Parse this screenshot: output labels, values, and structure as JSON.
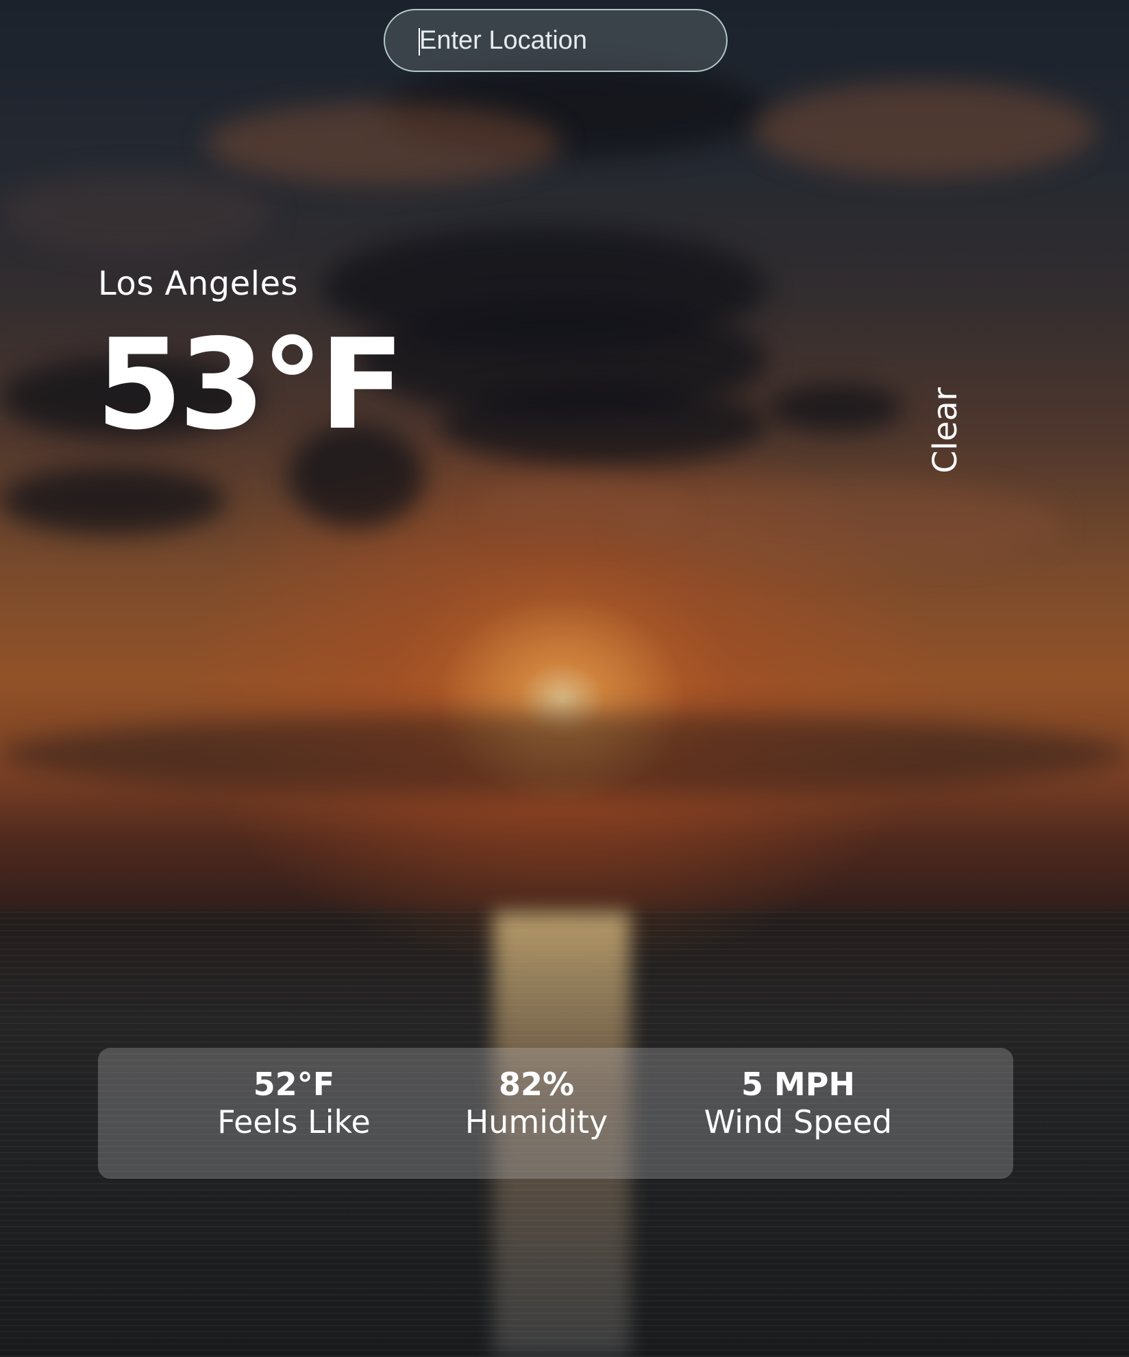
{
  "search": {
    "placeholder": "Enter Location",
    "value": ""
  },
  "weather": {
    "location": "Los Angeles",
    "temperature": "53°F",
    "condition": "Clear"
  },
  "stats": [
    {
      "value": "52°F",
      "label": "Feels Like"
    },
    {
      "value": "82%",
      "label": "Humidity"
    },
    {
      "value": "5 MPH",
      "label": "Wind Speed"
    }
  ],
  "colors": {
    "text": "#ffffff",
    "card_background": "rgba(200,200,205,0.28)",
    "search_border": "#c8e1e1"
  }
}
